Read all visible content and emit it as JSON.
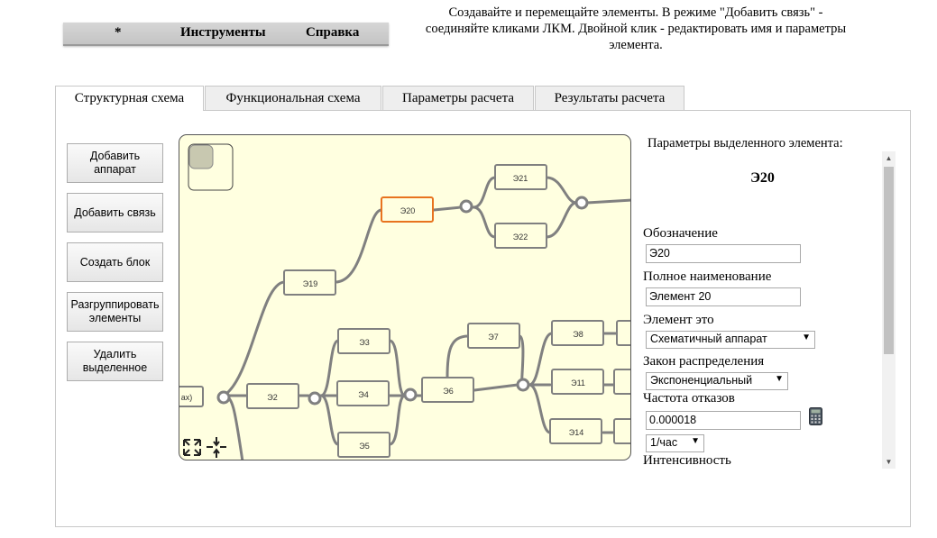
{
  "menu": {
    "star": "*",
    "tools": "Инструменты",
    "help": "Справка"
  },
  "hint": "Создавайте и перемещайте элементы. В режиме \"Добавить связь\" - соединяйте кликами ЛКМ. Двойной клик - редактировать имя и параметры элемента.",
  "tabs": [
    {
      "label": "Структурная схема",
      "active": true
    },
    {
      "label": "Функциональная схема"
    },
    {
      "label": "Параметры расчета"
    },
    {
      "label": "Результаты расчета"
    }
  ],
  "buttons": {
    "add_device": "Добавить аппарат",
    "add_link": "Добавить связь",
    "create_block": "Создать блок",
    "ungroup": "Разгруппировать элементы",
    "delete_selected": "Удалить выделенное"
  },
  "diagram": {
    "nodes": [
      "ах)",
      "Э2",
      "Э3",
      "Э4",
      "Э5",
      "Э6",
      "Э7",
      "Э8",
      "Э11",
      "Э14",
      "Э19",
      "Э20",
      "Э21",
      "Э22"
    ],
    "selected": "Э20",
    "selected_color": "#e8731f",
    "edge_color": "#808080"
  },
  "props": {
    "title": "Параметры выделенного элемента:",
    "element_name": "Э20",
    "designation_label": "Обозначение",
    "designation_value": "Э20",
    "fullname_label": "Полное наименование",
    "fullname_value": "Элемент 20",
    "element_type_label": "Элемент это",
    "element_type_value": "Схематичный аппарат",
    "distribution_label": "Закон распределения",
    "distribution_value": "Экспоненциальный",
    "failure_rate_label": "Частота отказов",
    "failure_rate_value": "0.000018",
    "unit_value": "1/час",
    "intensity_label": "Интенсивность"
  }
}
